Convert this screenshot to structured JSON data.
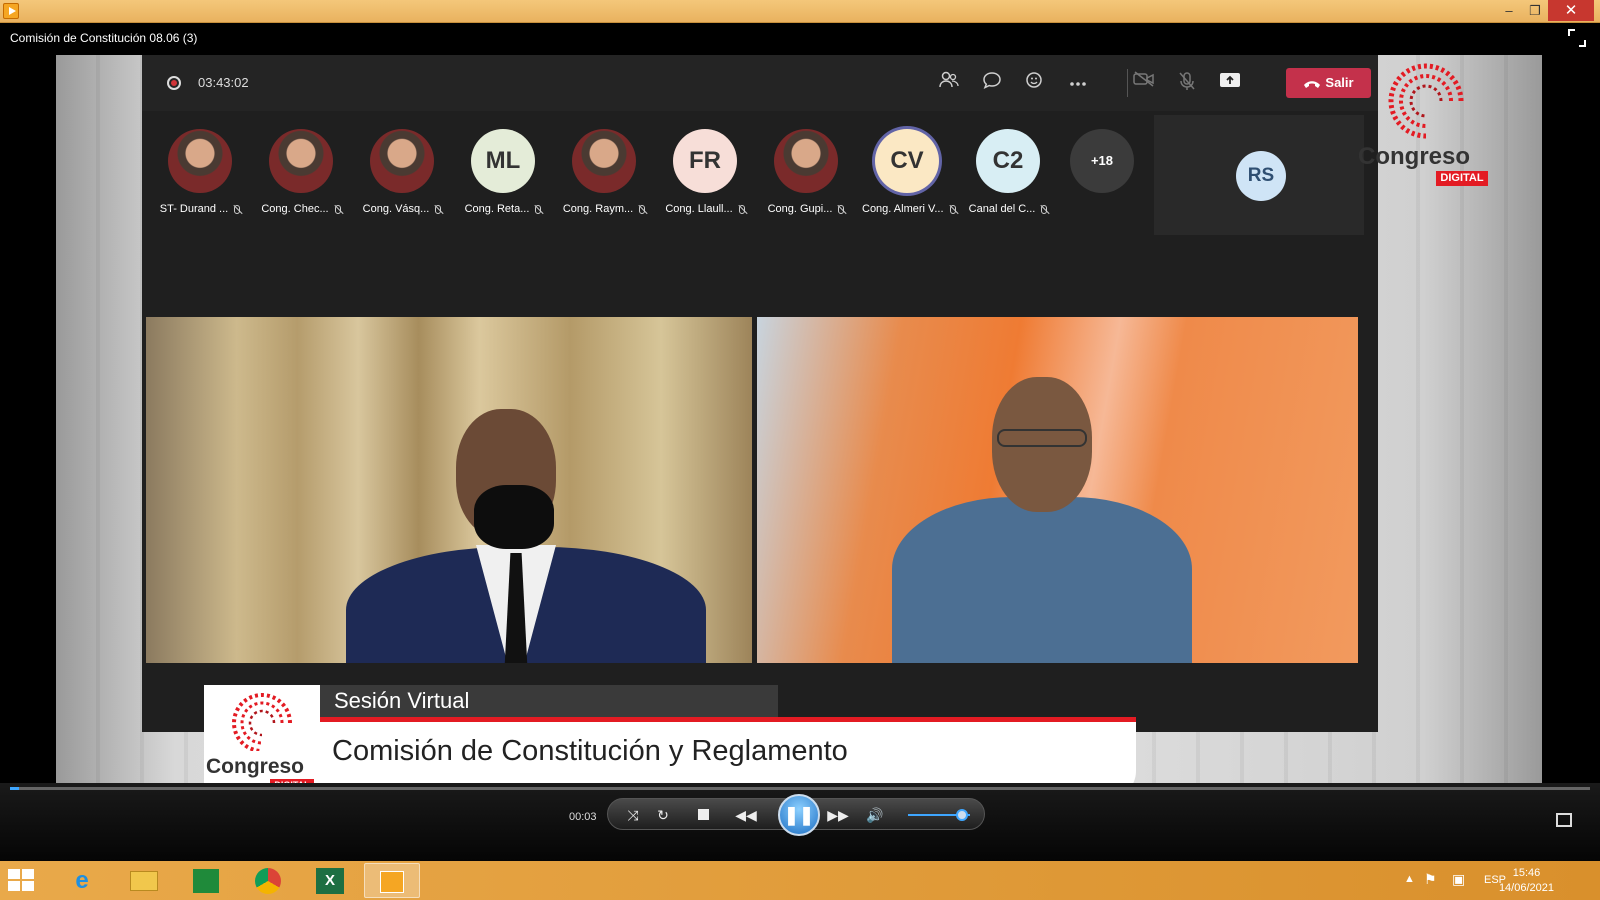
{
  "window": {
    "title_icon": "media-player-icon",
    "minimize": "–",
    "restore": "❐",
    "close": "✕"
  },
  "player": {
    "media_title": "Comisión de Constitución 08.06 (3)",
    "elapsed": "00:03",
    "progress": 0.006,
    "volume": 0.85
  },
  "teams": {
    "recording_time": "03:43:02",
    "leave_label": "Salir",
    "participants": [
      {
        "name": "ST- Durand ...",
        "initials": "",
        "kind": "photo"
      },
      {
        "name": "Cong. Chec...",
        "initials": "",
        "kind": "photo"
      },
      {
        "name": "Cong. Vásq...",
        "initials": "",
        "kind": "photo"
      },
      {
        "name": "Cong. Reta...",
        "initials": "ML",
        "kind": "initials",
        "color": "#e4ecd8"
      },
      {
        "name": "Cong. Raym...",
        "initials": "",
        "kind": "photo"
      },
      {
        "name": "Cong. Llaull...",
        "initials": "FR",
        "kind": "initials",
        "color": "#f7ded8"
      },
      {
        "name": "Cong. Gupi...",
        "initials": "",
        "kind": "photo"
      },
      {
        "name": "Cong. Almeri V...",
        "initials": "CV",
        "kind": "initials",
        "color": "#fbe8c4"
      },
      {
        "name": "Canal del C...",
        "initials": "C2",
        "kind": "initials",
        "color": "#d8eef4"
      }
    ],
    "more_count": "+18",
    "self_initials": "RS"
  },
  "overlay": {
    "brand": "Congreso",
    "brand_badge": "DIGITAL",
    "session_label": "Sesión Virtual",
    "committee": "Comisión de Constitución y Reglamento"
  },
  "taskbar": {
    "lang": "ESP",
    "time": "15:46",
    "date": "14/06/2021"
  },
  "colors": {
    "leave": "#c4314b",
    "accent_red": "#e31b23",
    "taskbar": "#e9a94a"
  }
}
